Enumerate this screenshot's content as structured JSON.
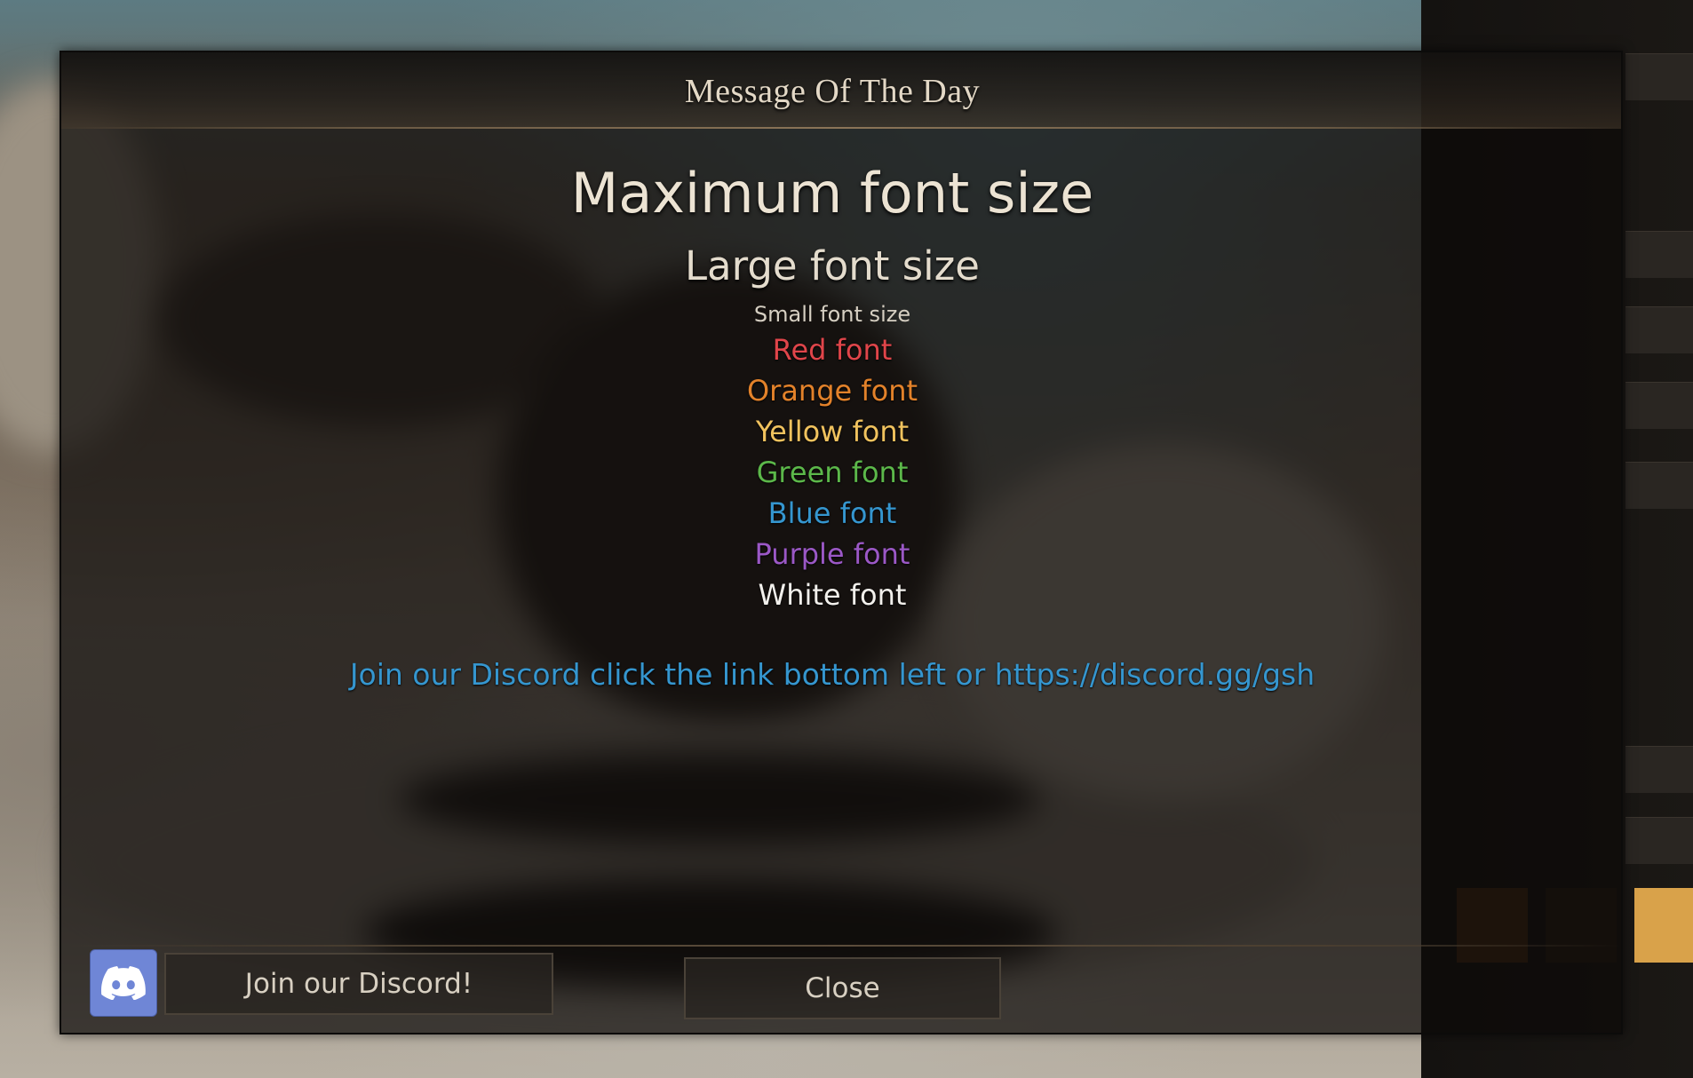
{
  "dialog": {
    "title": "Message Of The Day"
  },
  "motd": {
    "max_text": "Maximum font size",
    "large_text": "Large font size",
    "small_text": "Small font size",
    "colored_lines": [
      {
        "text": "Red font",
        "color": "#e0454a"
      },
      {
        "text": "Orange font",
        "color": "#e3822a"
      },
      {
        "text": "Yellow font",
        "color": "#f0c25e"
      },
      {
        "text": "Green font",
        "color": "#5cb84a"
      },
      {
        "text": "Blue font",
        "color": "#3596cf"
      },
      {
        "text": "Purple font",
        "color": "#9b58c6"
      },
      {
        "text": "White font",
        "color": "#f2f0ec"
      }
    ],
    "discord_line": "Join our Discord click the link bottom left or https://discord.gg/gsh",
    "discord_line_color": "#3596cf"
  },
  "footer": {
    "discord_icon": "discord-icon",
    "discord_icon_color": "#6f86d6",
    "join_label": "Join our Discord!",
    "close_label": "Close"
  }
}
